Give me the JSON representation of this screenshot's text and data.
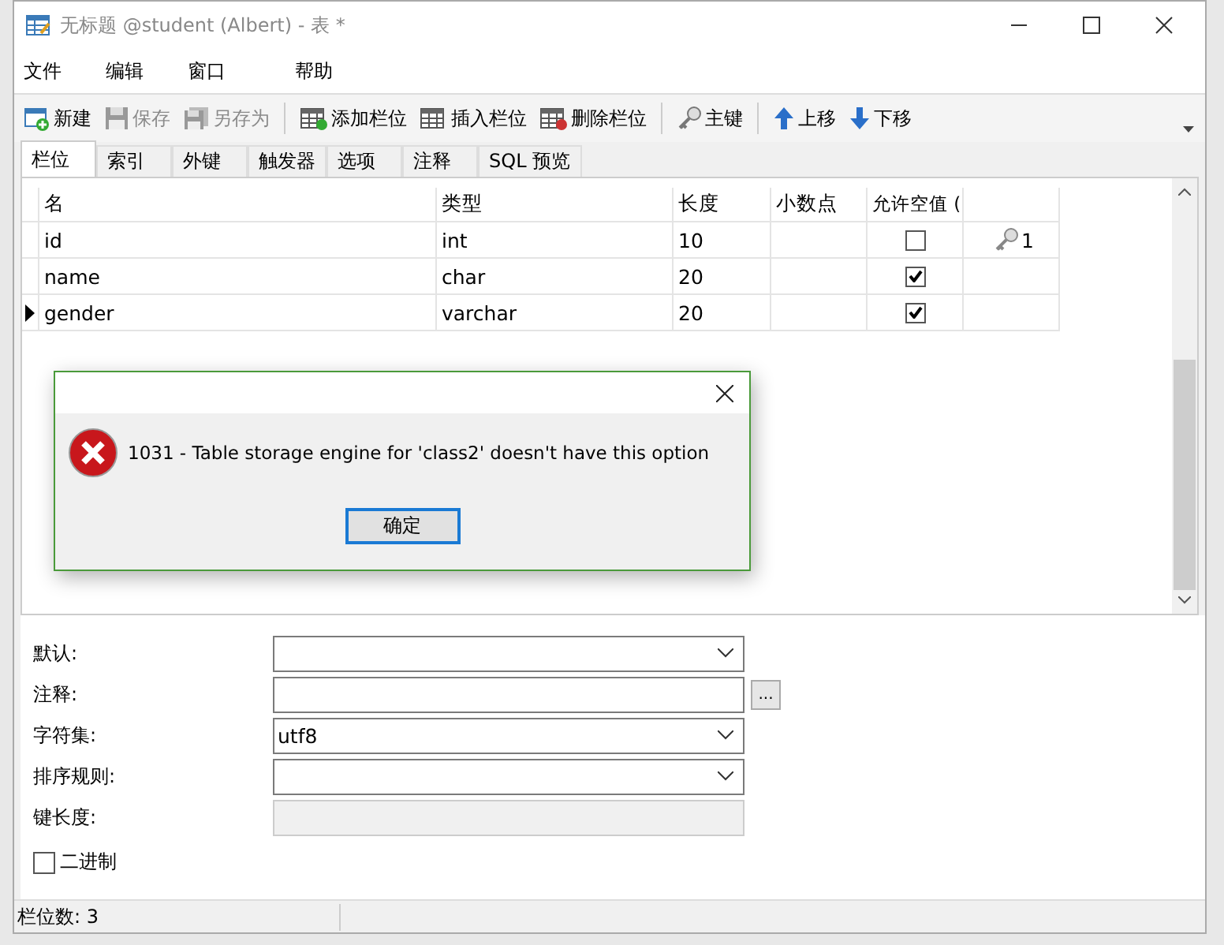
{
  "window": {
    "title": "无标题 @student (Albert) - 表 *"
  },
  "menu": [
    "文件",
    "编辑",
    "窗口",
    "帮助"
  ],
  "toolbar": [
    {
      "label": "新建",
      "disabled": false
    },
    {
      "label": "保存",
      "disabled": true
    },
    {
      "label": "另存为",
      "disabled": true
    },
    {
      "label": "添加栏位",
      "disabled": false
    },
    {
      "label": "插入栏位",
      "disabled": false
    },
    {
      "label": "删除栏位",
      "disabled": false
    },
    {
      "label": "主键",
      "disabled": false
    },
    {
      "label": "上移",
      "disabled": false
    },
    {
      "label": "下移",
      "disabled": false
    }
  ],
  "tabs": [
    {
      "label": "栏位",
      "selected": true
    },
    {
      "label": "索引",
      "selected": false
    },
    {
      "label": "外键",
      "selected": false
    },
    {
      "label": "触发器",
      "selected": false
    },
    {
      "label": "选项",
      "selected": false
    },
    {
      "label": "注释",
      "selected": false
    },
    {
      "label": "SQL 预览",
      "selected": false
    }
  ],
  "table": {
    "columns": [
      "名",
      "类型",
      "长度",
      "小数点",
      "允许空值 ("
    ],
    "rows": [
      {
        "name": "id",
        "type": "int",
        "length": "10",
        "nullable": false,
        "key": "1",
        "current": false
      },
      {
        "name": "name",
        "type": "char",
        "length": "20",
        "nullable": true,
        "current": false
      },
      {
        "name": "gender",
        "type": "varchar",
        "length": "20",
        "nullable": true,
        "current": true
      }
    ]
  },
  "dialog": {
    "message": "1031 - Table storage engine for 'class2' doesn't have this option",
    "button": "确定"
  },
  "properties": [
    {
      "label": "默认:",
      "kind": "dropdown"
    },
    {
      "label": "注释:",
      "kind": "text",
      "button": "..."
    },
    {
      "label": "字符集:",
      "kind": "dropdown",
      "value": "utf8"
    },
    {
      "label": "排序规则:",
      "kind": "dropdown"
    },
    {
      "label": "键长度:",
      "kind": "readonly"
    }
  ],
  "binary": {
    "label": "二进制",
    "checked": false
  },
  "status_bar": "栏位数: 3"
}
